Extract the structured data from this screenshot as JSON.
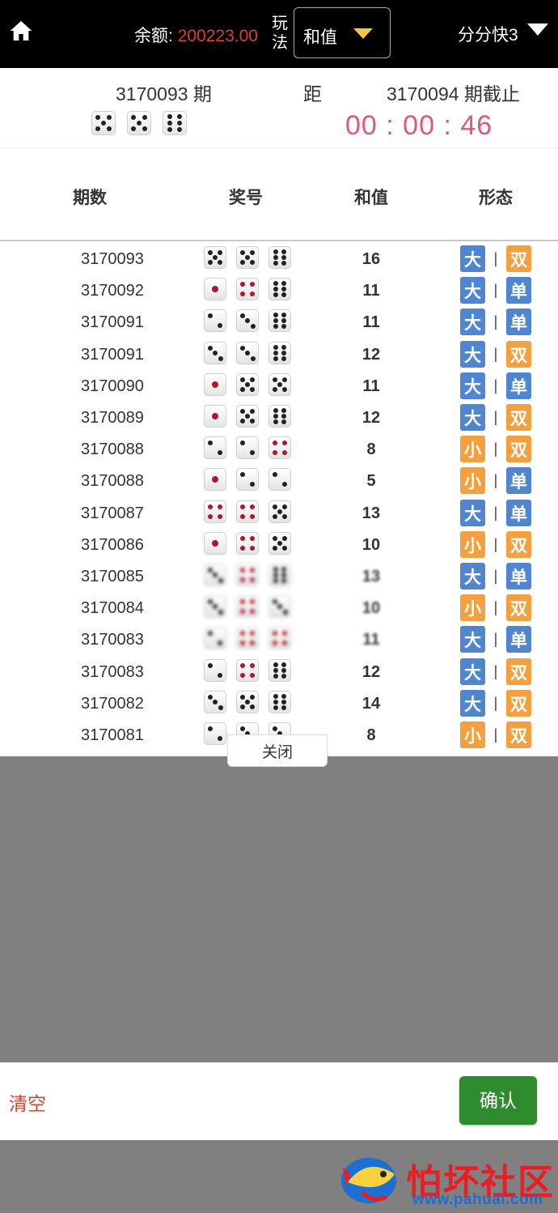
{
  "header": {
    "home_icon": "home-icon",
    "balance_label": "余额:",
    "balance_value": "200223.00",
    "play_label": "玩法",
    "play_value": "和值",
    "game_name": "分分快3",
    "colors": {
      "balance": "#e53935",
      "caret": "#f4c542"
    }
  },
  "draw": {
    "current_period": "3170093 期",
    "distance_label": "距",
    "next_period": "3170094 期截止",
    "countdown": "00 : 00 : 46",
    "current_dice": [
      5,
      5,
      6
    ]
  },
  "table": {
    "headers": [
      "期数",
      "奖号",
      "和值",
      "形态"
    ],
    "rows": [
      {
        "period": "3170093",
        "dice": [
          5,
          5,
          6
        ],
        "sum": "16",
        "size": "大",
        "parity": "双"
      },
      {
        "period": "3170092",
        "dice": [
          1,
          4,
          6
        ],
        "sum": "11",
        "size": "大",
        "parity": "单"
      },
      {
        "period": "3170091",
        "dice": [
          2,
          3,
          6
        ],
        "sum": "11",
        "size": "大",
        "parity": "单"
      },
      {
        "period": "3170091",
        "dice": [
          3,
          3,
          6
        ],
        "sum": "12",
        "size": "大",
        "parity": "双"
      },
      {
        "period": "3170090",
        "dice": [
          1,
          5,
          5
        ],
        "sum": "11",
        "size": "大",
        "parity": "单"
      },
      {
        "period": "3170089",
        "dice": [
          1,
          5,
          6
        ],
        "sum": "12",
        "size": "大",
        "parity": "双"
      },
      {
        "period": "3170088",
        "dice": [
          2,
          2,
          4
        ],
        "sum": "8",
        "size": "小",
        "parity": "双"
      },
      {
        "period": "3170088",
        "dice": [
          1,
          2,
          2
        ],
        "sum": "5",
        "size": "小",
        "parity": "单"
      },
      {
        "period": "3170087",
        "dice": [
          4,
          4,
          5
        ],
        "sum": "13",
        "size": "大",
        "parity": "单"
      },
      {
        "period": "3170086",
        "dice": [
          1,
          4,
          5
        ],
        "sum": "10",
        "size": "小",
        "parity": "双"
      },
      {
        "period": "3170085",
        "dice": [
          3,
          4,
          6
        ],
        "sum": "13",
        "size": "大",
        "parity": "单",
        "blurred": true
      },
      {
        "period": "3170084",
        "dice": [
          3,
          4,
          3
        ],
        "sum": "10",
        "size": "小",
        "parity": "双",
        "blurred": true
      },
      {
        "period": "3170083",
        "dice": [
          2,
          4,
          4
        ],
        "sum": "11",
        "size": "大",
        "parity": "单",
        "blurred": true
      },
      {
        "period": "3170083",
        "dice": [
          2,
          4,
          6
        ],
        "sum": "12",
        "size": "大",
        "parity": "双"
      },
      {
        "period": "3170082",
        "dice": [
          3,
          5,
          6
        ],
        "sum": "14",
        "size": "大",
        "parity": "双"
      },
      {
        "period": "3170081",
        "dice": [
          2,
          3,
          3
        ],
        "sum": "8",
        "size": "小",
        "parity": "双"
      }
    ],
    "badge_colors": {
      "big": "#4f86cf",
      "small": "#f2a040",
      "odd": "#4f86cf",
      "even": "#f2a040"
    },
    "close_label": "关闭"
  },
  "footer": {
    "clear_label": "清空",
    "confirm_label": "确认",
    "colors": {
      "clear": "#d9442c",
      "confirm": "#2e8b2e"
    }
  },
  "watermark": {
    "title": "怕坏社区",
    "url": "www.pahuai.com"
  }
}
